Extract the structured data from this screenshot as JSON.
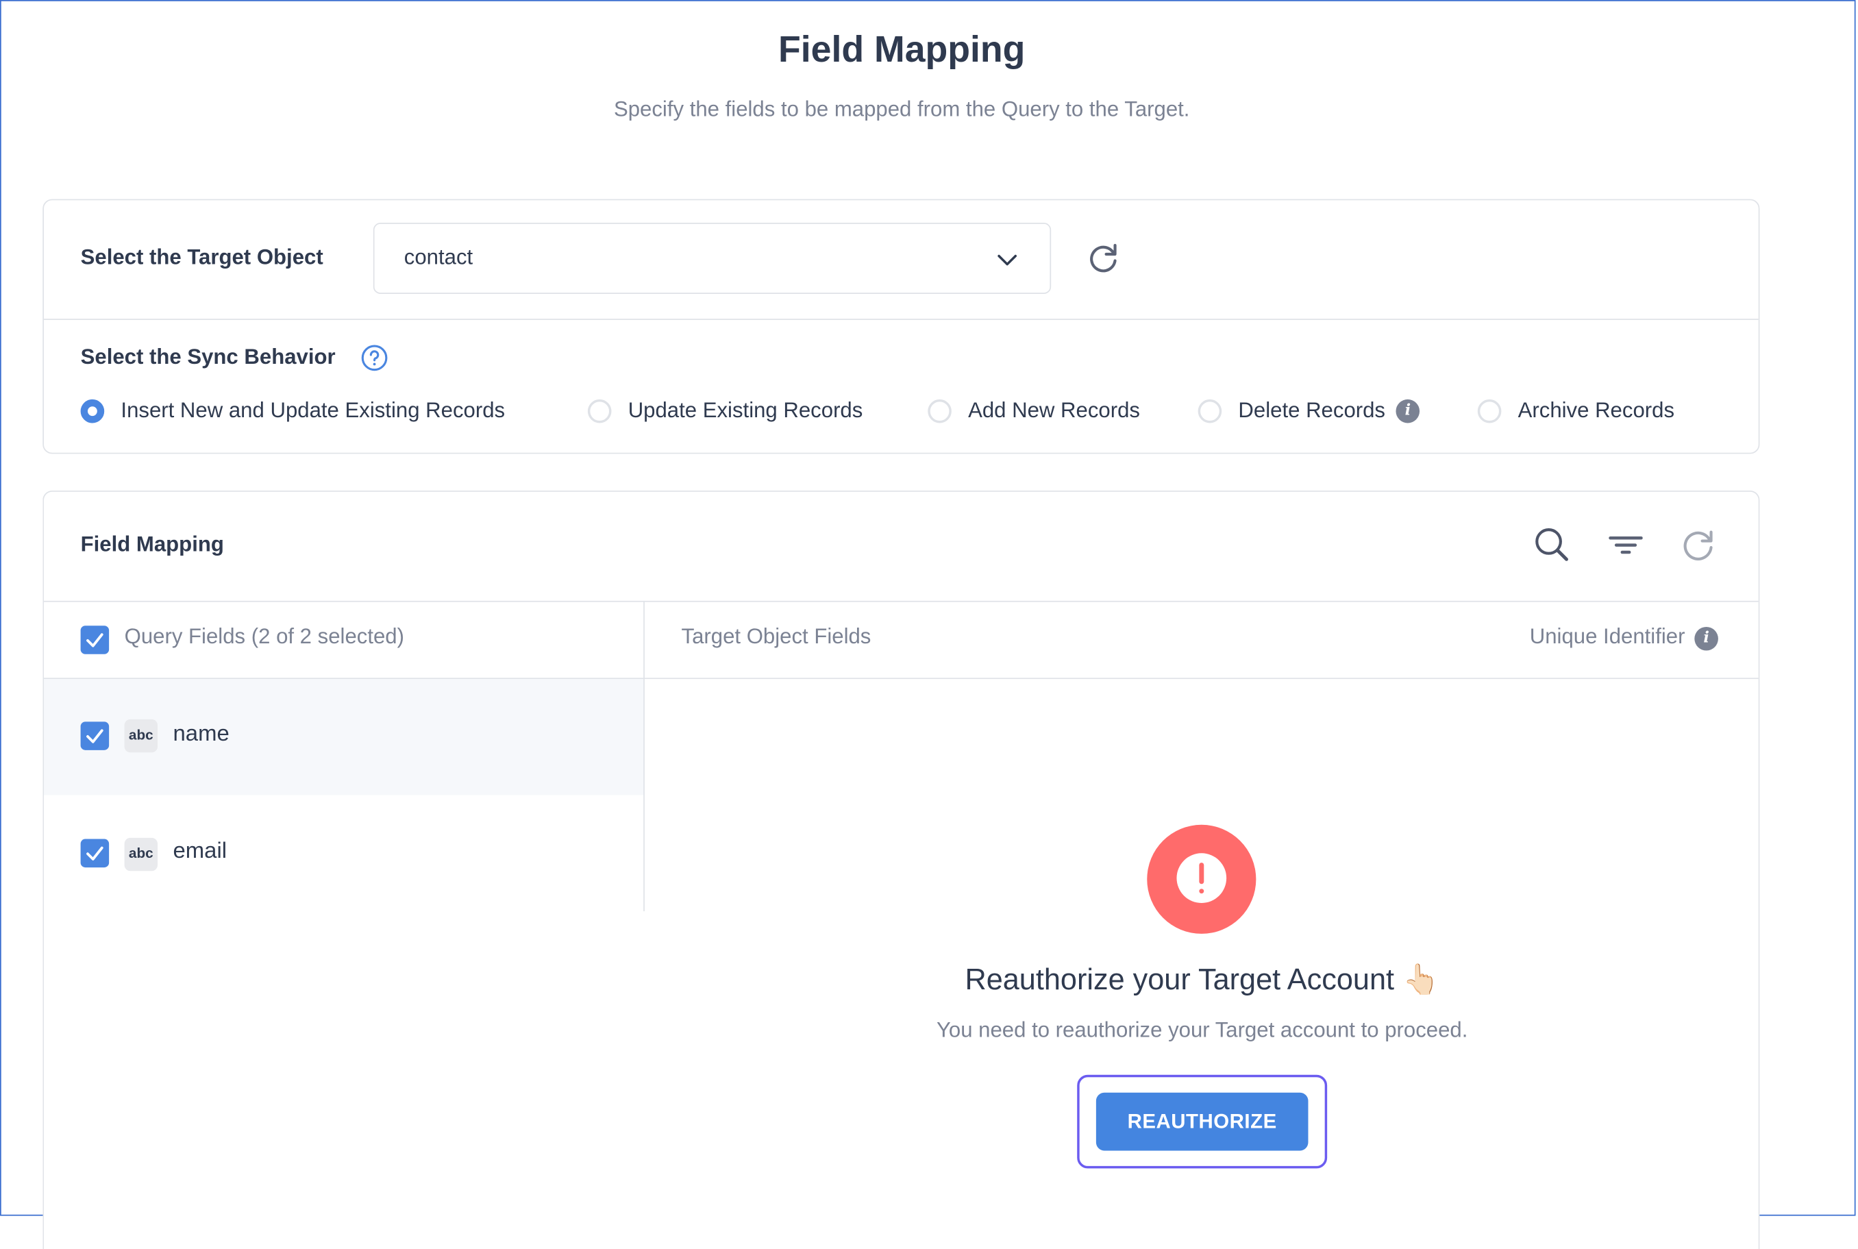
{
  "page": {
    "title": "Field Mapping",
    "subtitle": "Specify the fields to be mapped from the Query to the Target."
  },
  "target_object": {
    "label": "Select the Target Object",
    "selected_value": "contact",
    "icons": {
      "dropdown": "chevron-down-icon",
      "refresh": "refresh-icon"
    }
  },
  "sync_behavior": {
    "label": "Select the Sync Behavior",
    "help_icon": "question-circle-icon",
    "options": [
      {
        "label": "Insert New and Update Existing Records",
        "selected": true
      },
      {
        "label": "Update Existing Records",
        "selected": false
      },
      {
        "label": "Add New Records",
        "selected": false
      },
      {
        "label": "Delete Records",
        "selected": false,
        "info_icon": "info-icon"
      },
      {
        "label": "Archive Records",
        "selected": false
      }
    ],
    "info_glyph": "i"
  },
  "field_mapping": {
    "title": "Field Mapping",
    "toolbar": {
      "search": "search-icon",
      "filter": "filter-icon",
      "refresh": "refresh-icon"
    },
    "columns": {
      "query_fields": "Query Fields (2 of 2 selected)",
      "target_fields": "Target Object Fields",
      "unique_identifier": "Unique Identifier"
    },
    "rows": [
      {
        "type_badge": "abc",
        "name": "name",
        "checked": true
      },
      {
        "type_badge": "abc",
        "name": "email",
        "checked": true
      }
    ]
  },
  "reauthorize": {
    "title": "Reauthorize your Target Account 👆🏻",
    "message": "You need to reauthorize your Target account to proceed.",
    "button_label": "REAUTHORIZE"
  },
  "colors": {
    "accent": "#4a86e0",
    "error": "#ff6b6b",
    "focus_ring": "#6b5cf0",
    "text_primary": "#2f3a4f",
    "text_muted": "#7b8293"
  }
}
